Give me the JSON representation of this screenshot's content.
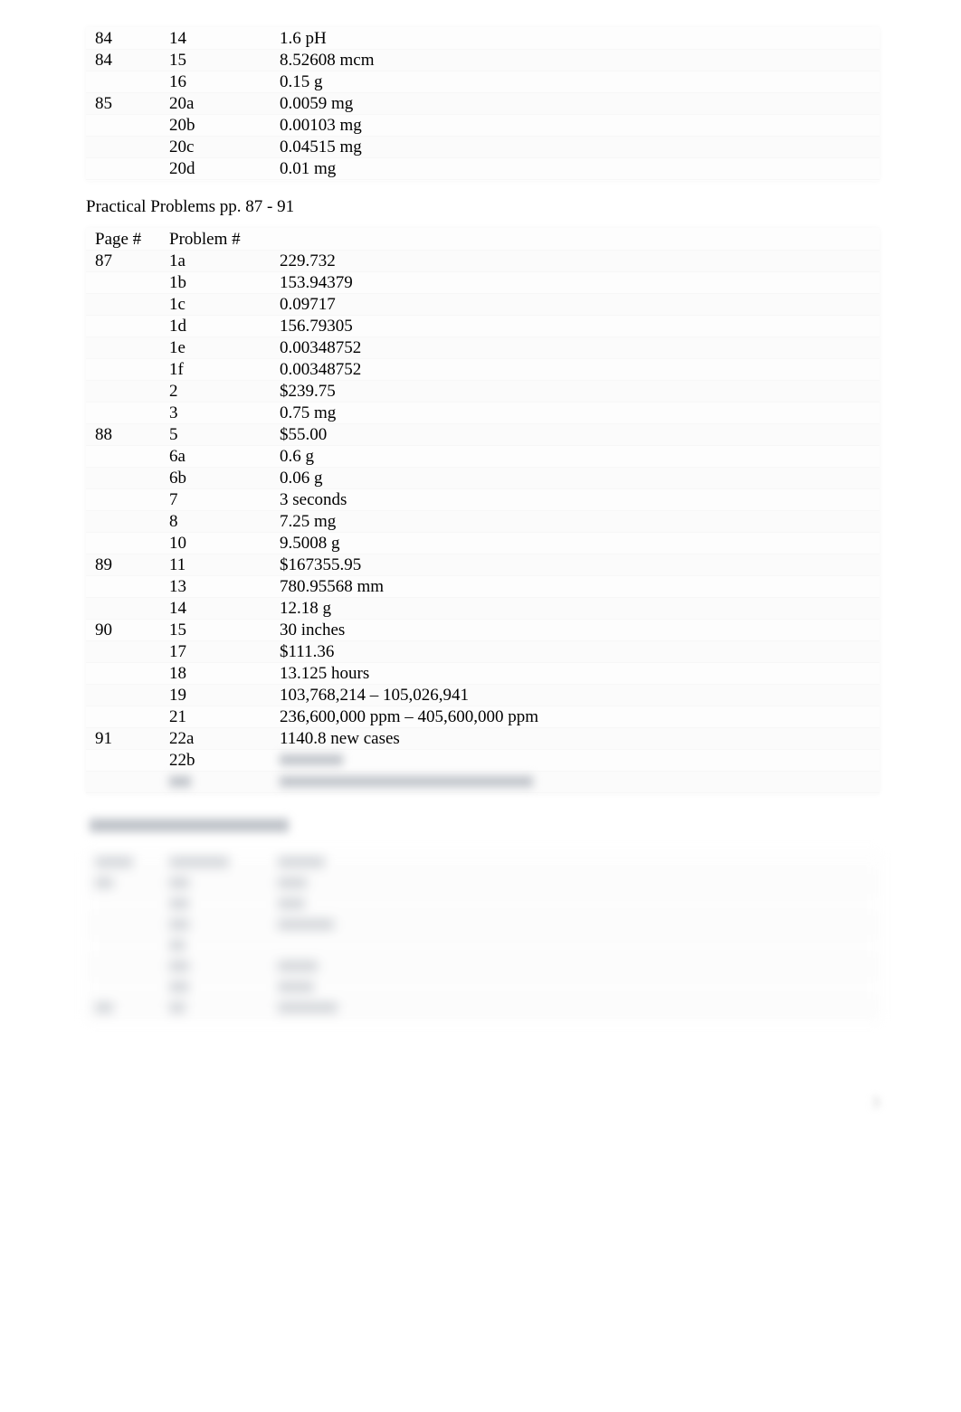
{
  "section1": {
    "rows": [
      {
        "page": "84",
        "prob": "14",
        "ans": "1.6 pH"
      },
      {
        "page": "84",
        "prob": "15",
        "ans": "8.52608 mcm"
      },
      {
        "page": "",
        "prob": "16",
        "ans": "0.15 g"
      },
      {
        "page": "85",
        "prob": "20a",
        "ans": "0.0059 mg"
      },
      {
        "page": "",
        "prob": "20b",
        "ans": "0.00103 mg"
      },
      {
        "page": "",
        "prob": "20c",
        "ans": "0.04515 mg"
      },
      {
        "page": "",
        "prob": "20d",
        "ans": "0.01 mg"
      }
    ]
  },
  "section2": {
    "title": "Practical Problems pp. 87 - 91",
    "headers": {
      "page": "Page #",
      "prob": "Problem #",
      "ans": ""
    },
    "rows": [
      {
        "page": "87",
        "prob": "1a",
        "ans": "229.732"
      },
      {
        "page": "",
        "prob": "1b",
        "ans": "153.94379"
      },
      {
        "page": "",
        "prob": "1c",
        "ans": "0.09717"
      },
      {
        "page": "",
        "prob": "1d",
        "ans": "156.79305"
      },
      {
        "page": "",
        "prob": "1e",
        "ans": "0.00348752"
      },
      {
        "page": "",
        "prob": "1f",
        "ans": "0.00348752"
      },
      {
        "page": "",
        "prob": "2",
        "ans": "$239.75"
      },
      {
        "page": "",
        "prob": "3",
        "ans": "0.75 mg"
      },
      {
        "page": "88",
        "prob": "5",
        "ans": "$55.00"
      },
      {
        "page": "",
        "prob": "6a",
        "ans": "0.6 g"
      },
      {
        "page": "",
        "prob": "6b",
        "ans": "0.06 g"
      },
      {
        "page": "",
        "prob": "7",
        "ans": "3 seconds"
      },
      {
        "page": "",
        "prob": "8",
        "ans": "7.25 mg"
      },
      {
        "page": "",
        "prob": "10",
        "ans": "9.5008 g"
      },
      {
        "page": "89",
        "prob": "11",
        "ans": "$167355.95"
      },
      {
        "page": "",
        "prob": "13",
        "ans": "780.95568 mm"
      },
      {
        "page": "",
        "prob": "14",
        "ans": "12.18 g"
      },
      {
        "page": "90",
        "prob": "15",
        "ans": "30 inches"
      },
      {
        "page": "",
        "prob": "17",
        "ans": "$111.36"
      },
      {
        "page": "",
        "prob": "18",
        "ans": "13.125 hours"
      },
      {
        "page": "",
        "prob": "19",
        "ans": "103,768,214 – 105,026,941"
      },
      {
        "page": "",
        "prob": "21",
        "ans": "236,600,000 ppm – 405,600,000 ppm"
      },
      {
        "page": "91",
        "prob": "22a",
        "ans": "1140.8 new cases"
      },
      {
        "page": "",
        "prob": "22b",
        "ans": ""
      },
      {
        "page": "",
        "prob": "",
        "ans": ""
      }
    ]
  }
}
